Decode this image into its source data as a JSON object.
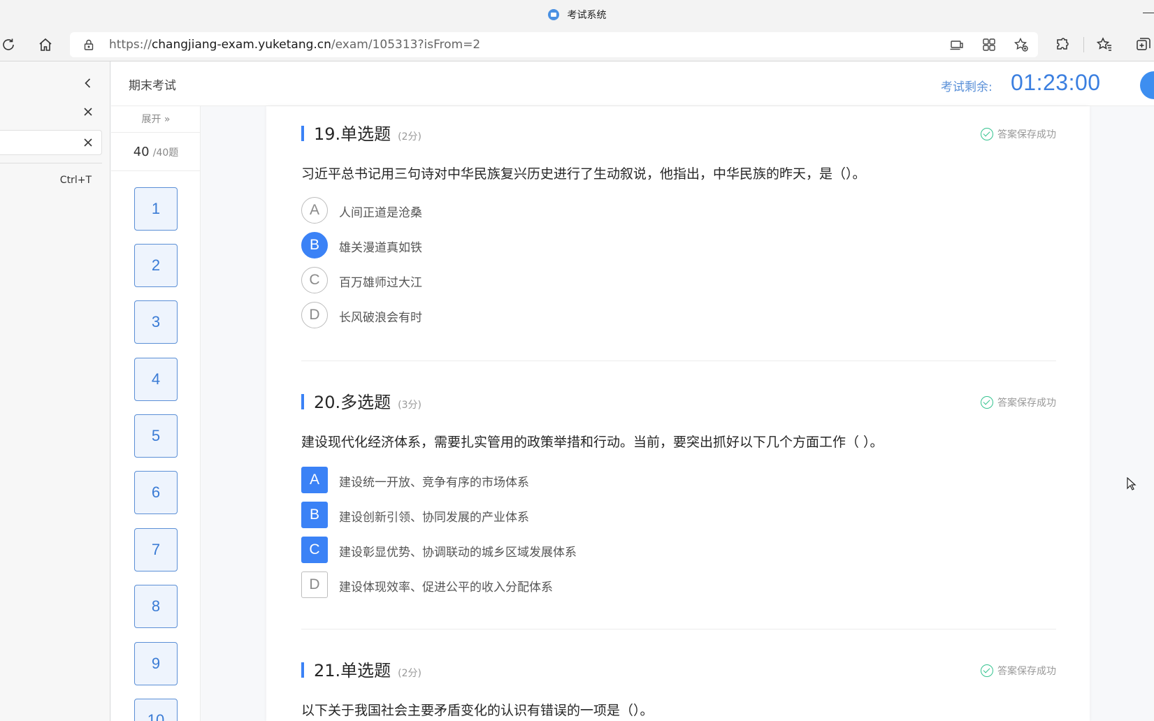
{
  "browser": {
    "window_title": "考试系统",
    "url_prefix": "https://",
    "url_host": "changjiang-exam.yuketang.cn",
    "url_path": "/exam/105313?isFrom=2"
  },
  "left_panel": {
    "shortcut": "Ctrl+T"
  },
  "exam": {
    "name": "期末考试",
    "remaining_label": "考试剩余:",
    "timer": "01:23:00"
  },
  "sheet": {
    "expand_label": "展开 »",
    "answered": "40",
    "total": "/40题",
    "numbers": [
      "1",
      "2",
      "3",
      "4",
      "5",
      "6",
      "7",
      "8",
      "9",
      "10"
    ]
  },
  "questions": [
    {
      "title": "19.单选题",
      "score": "(2分)",
      "saved": "答案保存成功",
      "stem": "习近平总书记用三句诗对中华民族复兴历史进行了生动叙说，他指出，中华民族的昨天，是（）。",
      "options": [
        {
          "letter": "A",
          "text": "人间正道是沧桑",
          "selected": false
        },
        {
          "letter": "B",
          "text": "雄关漫道真如铁",
          "selected": true
        },
        {
          "letter": "C",
          "text": "百万雄师过大江",
          "selected": false
        },
        {
          "letter": "D",
          "text": "长风破浪会有时",
          "selected": false
        }
      ]
    },
    {
      "title": "20.多选题",
      "score": "(3分)",
      "saved": "答案保存成功",
      "stem": "建设现代化经济体系，需要扎实管用的政策举措和行动。当前，要突出抓好以下几个方面工作（ ）。",
      "options": [
        {
          "letter": "A",
          "text": "建设统一开放、竞争有序的市场体系",
          "selected": true
        },
        {
          "letter": "B",
          "text": "建设创新引领、协同发展的产业体系",
          "selected": true
        },
        {
          "letter": "C",
          "text": "建设彰显优势、协调联动的城乡区域发展体系",
          "selected": true
        },
        {
          "letter": "D",
          "text": "建设体现效率、促进公平的收入分配体系",
          "selected": false
        }
      ]
    },
    {
      "title": "21.单选题",
      "score": "(2分)",
      "saved": "答案保存成功",
      "stem": "以下关于我国社会主要矛盾变化的认识有错误的一项是（）。",
      "options": []
    }
  ]
}
